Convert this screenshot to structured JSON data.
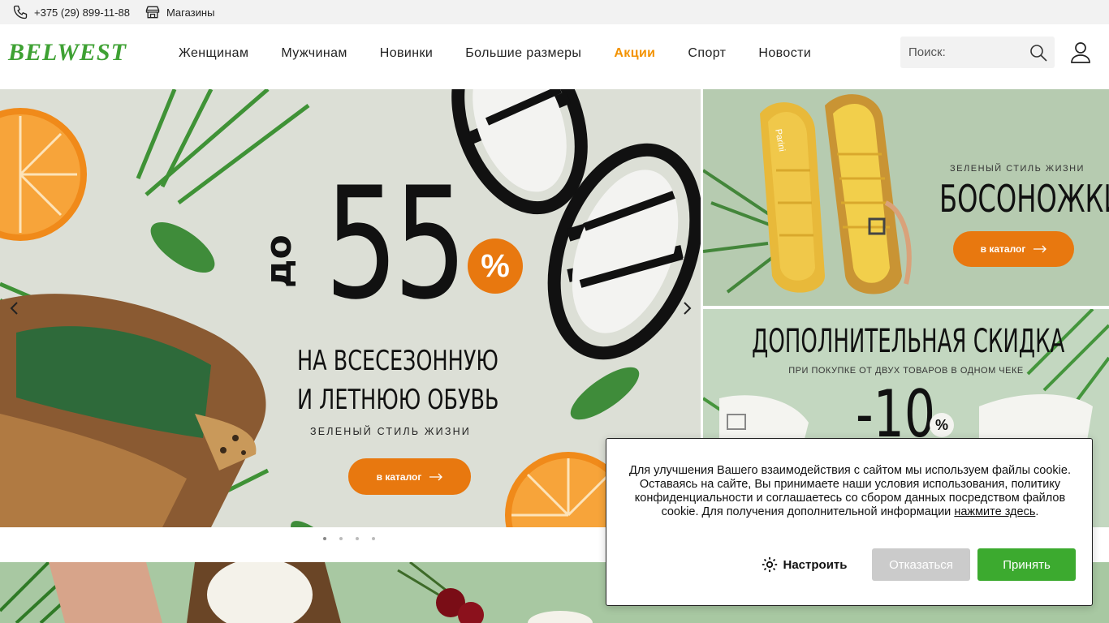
{
  "topbar": {
    "phone": "+375 (29) 899-11-88",
    "stores": "Магазины"
  },
  "header": {
    "logo": "BELWEST",
    "nav": [
      {
        "label": "Женщинам"
      },
      {
        "label": "Мужчинам"
      },
      {
        "label": "Новинки"
      },
      {
        "label": "Большие размеры"
      },
      {
        "label": "Акции"
      },
      {
        "label": "Спорт"
      },
      {
        "label": "Новости"
      }
    ],
    "search_placeholder": "Поиск:"
  },
  "hero": {
    "prefix": "до",
    "number": "55",
    "percent": "%",
    "line1": "НА ВСЕСЕЗОННУЮ",
    "line2": "И ЛЕТНЮЮ ОБУВЬ",
    "tagline": "ЗЕЛЕНЫЙ СТИЛЬ ЖИЗНИ",
    "button": "в каталог"
  },
  "side1": {
    "tagline": "ЗЕЛЕНЫЙ СТИЛЬ ЖИЗНИ",
    "title": "БОСОНОЖКИ",
    "brand": "Parini",
    "button": "в каталог"
  },
  "side2": {
    "title": "ДОПОЛНИТЕЛЬНАЯ СКИДКА",
    "subtitle": "ПРИ ПОКУПКЕ ОТ ДВУХ ТОВАРОВ В ОДНОМ ЧЕКЕ",
    "discount": "-10",
    "percent": "%"
  },
  "carousel": {
    "dots": 4,
    "active": 1
  },
  "cookie": {
    "text": "Для улучшения Вашего взаимодействия с сайтом мы используем файлы cookie. Оставаясь на сайте, Вы принимаете наши условия использования, политику конфиденциальности и соглашаетесь со сбором данных посредством файлов cookie. Для получения дополнительной информации",
    "link": "нажмите здесь",
    "after_link": ".",
    "settings": "Настроить",
    "reject": "Отказаться",
    "accept": "Принять"
  },
  "colors": {
    "accent": "#f39200",
    "brand_green": "#3ea133",
    "button_orange": "#e8780f",
    "accept_green": "#3caa2f"
  }
}
